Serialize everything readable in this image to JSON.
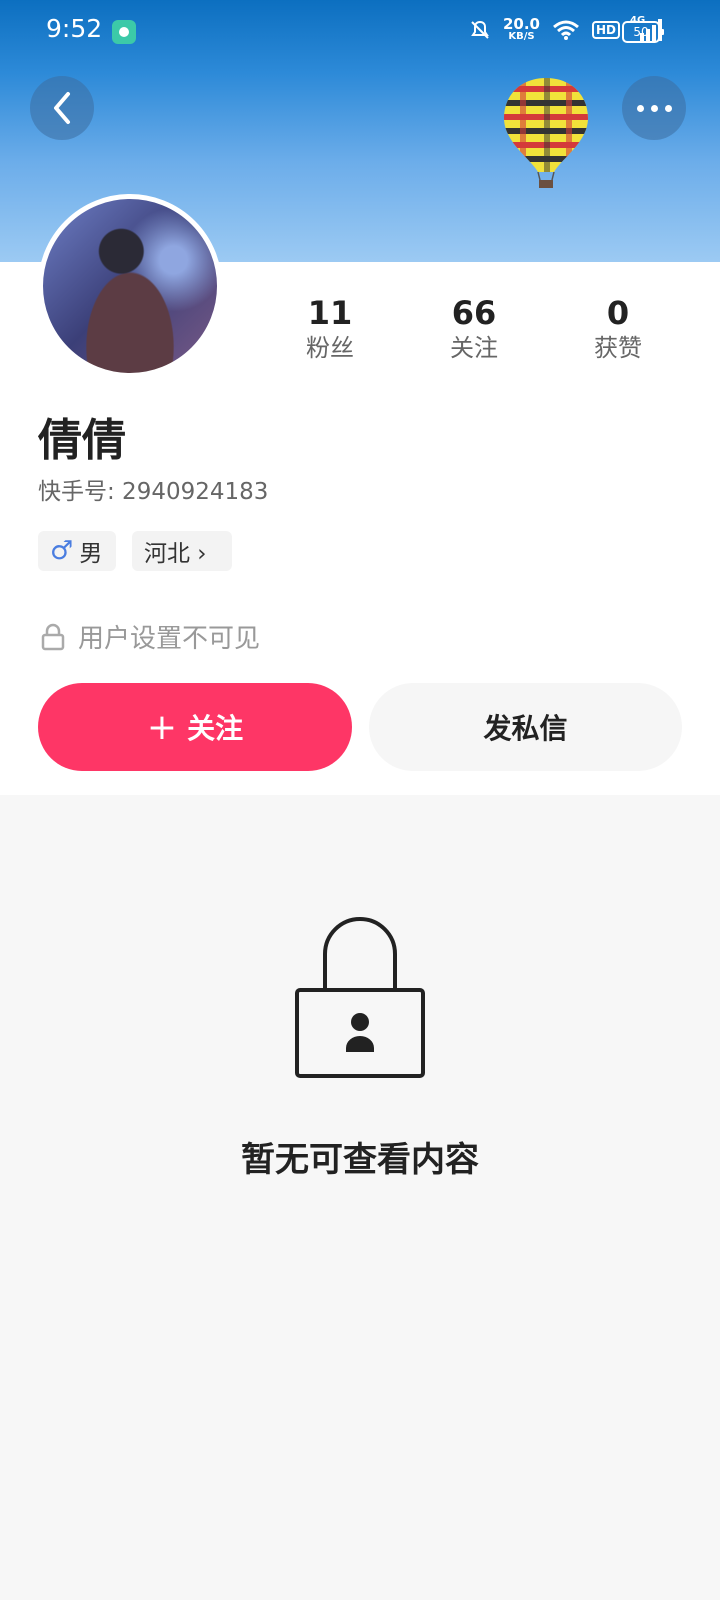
{
  "status_bar": {
    "time": "9:52",
    "speed_value": "20.0",
    "speed_unit": "KB/S",
    "hd_label": "HD",
    "network_label": "4G",
    "battery": "50"
  },
  "profile": {
    "name": "倩倩",
    "kuaishou_id": "快手号: 2940924183",
    "stats": [
      {
        "value": "11",
        "label": "粉丝"
      },
      {
        "value": "66",
        "label": "关注"
      },
      {
        "value": "0",
        "label": "获赞"
      }
    ],
    "gender_symbol": "♂",
    "gender": "男",
    "region": "河北 ›",
    "privacy_note": "用户设置不可见"
  },
  "actions": {
    "follow_plus": "+",
    "follow_label": "关注",
    "message_label": "发私信"
  },
  "content": {
    "empty_text": "暂无可查看内容"
  },
  "colors": {
    "accent": "#fe3666",
    "header_top": "#0c6fc0",
    "header_bottom": "#9ccaf3"
  },
  "icons": [
    "back-arrow-icon",
    "more-dots-icon",
    "hot-air-balloon-icon",
    "male-icon",
    "lock-icon",
    "lock-user-icon"
  ]
}
